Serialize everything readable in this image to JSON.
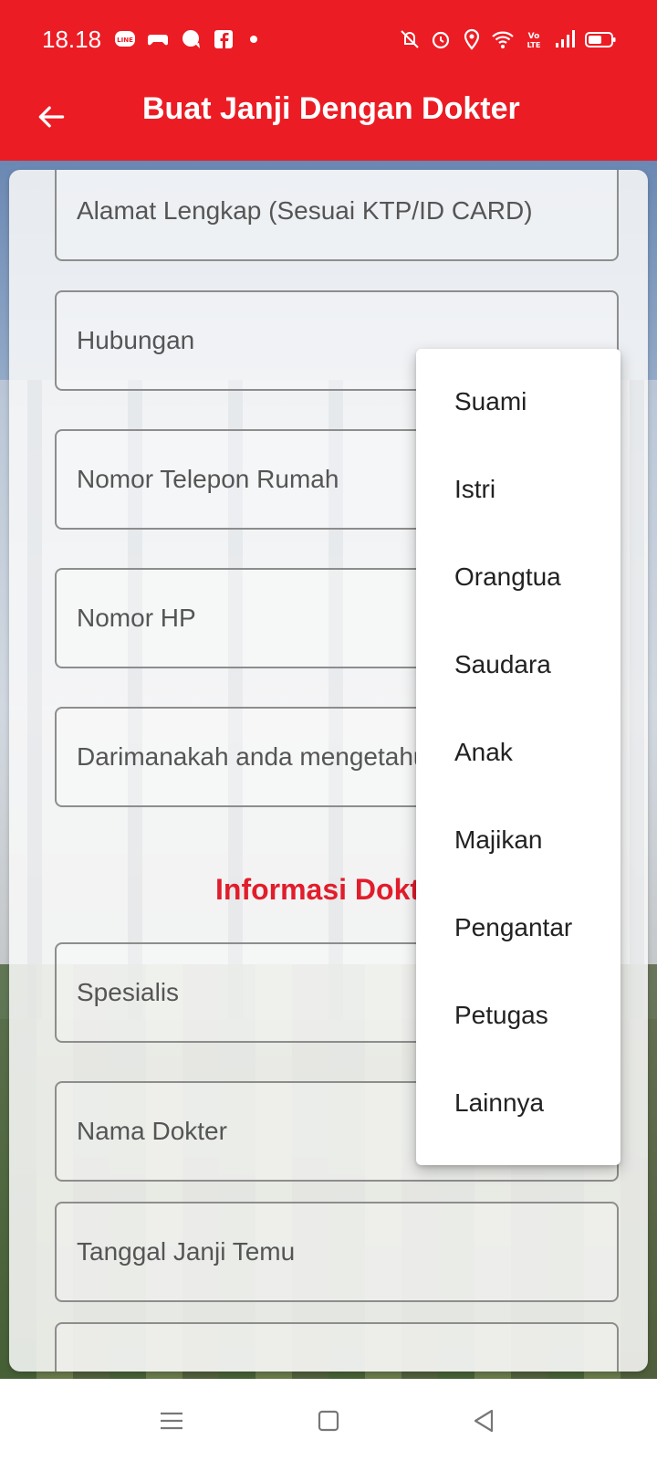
{
  "status_bar": {
    "time": "18.18",
    "notification_icons": [
      "line-icon",
      "game-controller-icon",
      "chat-bubble-icon",
      "facebook-icon"
    ],
    "system_icons": [
      "mute-vibrate-icon",
      "alarm-icon",
      "location-icon",
      "wifi-icon",
      "volte-icon",
      "signal-icon",
      "battery-icon"
    ]
  },
  "app_bar": {
    "title": "Buat Janji Dengan Dokter",
    "back_icon": "arrow-left-icon"
  },
  "form": {
    "fields": [
      {
        "label": "Alamat Lengkap (Sesuai KTP/ID CARD)"
      },
      {
        "label": "Hubungan"
      },
      {
        "label": "Nomor Telepon Rumah"
      },
      {
        "label": "Nomor HP"
      },
      {
        "label": "Darimanakah anda mengetahui"
      },
      {
        "label": "Spesialis"
      },
      {
        "label": "Nama Dokter"
      },
      {
        "label": "Tanggal Janji Temu"
      }
    ],
    "section_title": "Informasi Dokter"
  },
  "dropdown": {
    "items": [
      "Suami",
      "Istri",
      "Orangtua",
      "Saudara",
      "Anak",
      "Majikan",
      "Pengantar",
      "Petugas",
      "Lainnya"
    ]
  },
  "nav_bar": {
    "icons": [
      "menu-icon",
      "home-square-icon",
      "back-triangle-icon"
    ]
  },
  "colors": {
    "primary": "#ec1c24",
    "section_title": "#e11d2b"
  }
}
